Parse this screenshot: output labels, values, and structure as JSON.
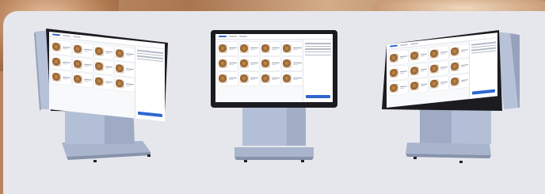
{
  "scene": {
    "description_colors": {
      "background_wood": "#b9835c",
      "panel": "#e6e7ec",
      "kiosk_body": "#aebbd3",
      "screen_bezel": "#1c1c20",
      "accent": "#2f66d0"
    }
  },
  "kiosks": [
    {
      "id": "left"
    },
    {
      "id": "center"
    },
    {
      "id": "right"
    }
  ]
}
